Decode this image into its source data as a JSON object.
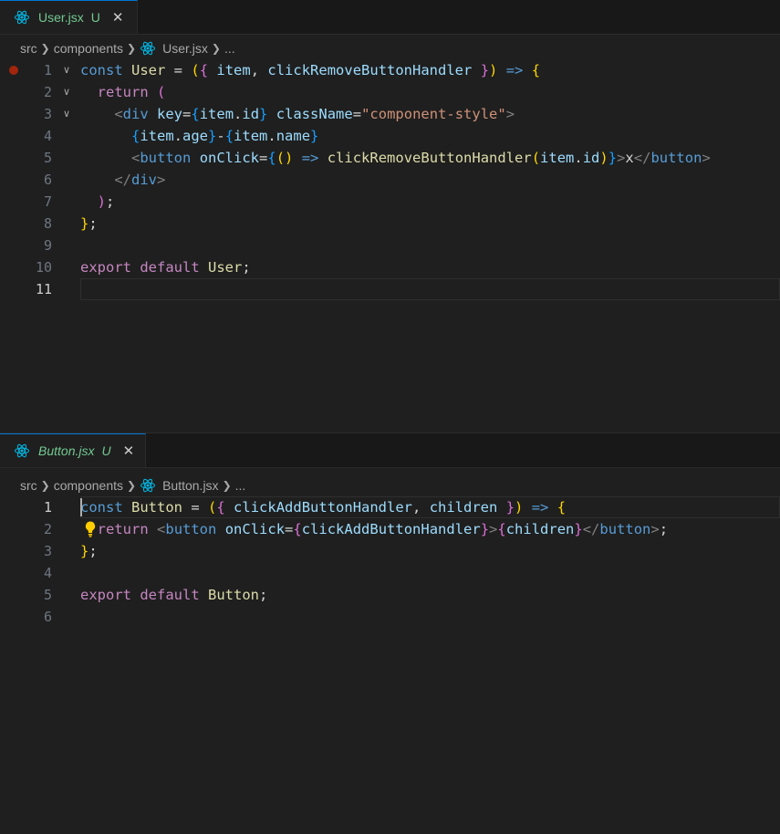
{
  "colors": {
    "accent": "#0078d4",
    "untracked": "#73c991",
    "breakpoint": "#a1260d",
    "react_icon": "#00b7e4",
    "bulb": "#ffcc00"
  },
  "panes": [
    {
      "tab": {
        "label": "User.jsx",
        "status": "U",
        "icon": "react-icon",
        "close": "✕"
      },
      "breadcrumb": {
        "parts": [
          "src",
          "components",
          "User.jsx",
          "..."
        ]
      },
      "lines": [
        {
          "number": "1",
          "active": false,
          "breakpoint": true,
          "fold": true,
          "tokens": [
            [
              "kw",
              "const"
            ],
            [
              "tx",
              " "
            ],
            [
              "fn",
              "User"
            ],
            [
              "tx",
              " = "
            ],
            [
              "b1",
              "("
            ],
            [
              "b2",
              "{"
            ],
            [
              "tx",
              " "
            ],
            [
              "vr",
              "item"
            ],
            [
              "tx",
              ", "
            ],
            [
              "vr",
              "clickRemoveButtonHandler"
            ],
            [
              "tx",
              " "
            ],
            [
              "b2",
              "}"
            ],
            [
              "b1",
              ")"
            ],
            [
              "tx",
              " "
            ],
            [
              "kw",
              "=>"
            ],
            [
              "tx",
              " "
            ],
            [
              "b1",
              "{"
            ]
          ]
        },
        {
          "number": "2",
          "active": false,
          "fold": true,
          "tokens": [
            [
              "tx",
              "  "
            ],
            [
              "kc",
              "return"
            ],
            [
              "tx",
              " "
            ],
            [
              "b2",
              "("
            ]
          ]
        },
        {
          "number": "3",
          "active": false,
          "fold": true,
          "tokens": [
            [
              "tx",
              "    "
            ],
            [
              "pu",
              "<"
            ],
            [
              "tg",
              "div"
            ],
            [
              "tx",
              " "
            ],
            [
              "at",
              "key"
            ],
            [
              "tx",
              "="
            ],
            [
              "b3",
              "{"
            ],
            [
              "vr",
              "item"
            ],
            [
              "tx",
              "."
            ],
            [
              "vr",
              "id"
            ],
            [
              "b3",
              "}"
            ],
            [
              "tx",
              " "
            ],
            [
              "at",
              "className"
            ],
            [
              "tx",
              "="
            ],
            [
              "st",
              "\"component-style\""
            ],
            [
              "pu",
              ">"
            ]
          ]
        },
        {
          "number": "4",
          "active": false,
          "tokens": [
            [
              "tx",
              "      "
            ],
            [
              "b3",
              "{"
            ],
            [
              "vr",
              "item"
            ],
            [
              "tx",
              "."
            ],
            [
              "vr",
              "age"
            ],
            [
              "b3",
              "}"
            ],
            [
              "tx",
              "-"
            ],
            [
              "b3",
              "{"
            ],
            [
              "vr",
              "item"
            ],
            [
              "tx",
              "."
            ],
            [
              "vr",
              "name"
            ],
            [
              "b3",
              "}"
            ]
          ]
        },
        {
          "number": "5",
          "active": false,
          "tokens": [
            [
              "tx",
              "      "
            ],
            [
              "pu",
              "<"
            ],
            [
              "tg",
              "button"
            ],
            [
              "tx",
              " "
            ],
            [
              "at",
              "onClick"
            ],
            [
              "tx",
              "="
            ],
            [
              "b3",
              "{"
            ],
            [
              "b1",
              "()"
            ],
            [
              "tx",
              " "
            ],
            [
              "kw",
              "=>"
            ],
            [
              "tx",
              " "
            ],
            [
              "fn",
              "clickRemoveButtonHandler"
            ],
            [
              "b1",
              "("
            ],
            [
              "vr",
              "item"
            ],
            [
              "tx",
              "."
            ],
            [
              "vr",
              "id"
            ],
            [
              "b1",
              ")"
            ],
            [
              "b3",
              "}"
            ],
            [
              "pu",
              ">"
            ],
            [
              "tx",
              "x"
            ],
            [
              "pu",
              "</"
            ],
            [
              "tg",
              "button"
            ],
            [
              "pu",
              ">"
            ]
          ]
        },
        {
          "number": "6",
          "active": false,
          "tokens": [
            [
              "tx",
              "    "
            ],
            [
              "pu",
              "</"
            ],
            [
              "tg",
              "div"
            ],
            [
              "pu",
              ">"
            ]
          ]
        },
        {
          "number": "7",
          "active": false,
          "tokens": [
            [
              "tx",
              "  "
            ],
            [
              "b2",
              ")"
            ],
            [
              "tx",
              ";"
            ]
          ]
        },
        {
          "number": "8",
          "active": false,
          "tokens": [
            [
              "b1",
              "}"
            ],
            [
              "tx",
              ";"
            ]
          ]
        },
        {
          "number": "9",
          "active": false,
          "tokens": []
        },
        {
          "number": "10",
          "active": false,
          "tokens": [
            [
              "kc",
              "export"
            ],
            [
              "tx",
              " "
            ],
            [
              "kc",
              "default"
            ],
            [
              "tx",
              " "
            ],
            [
              "fn",
              "User"
            ],
            [
              "tx",
              ";"
            ]
          ]
        },
        {
          "number": "11",
          "active": true,
          "current": true,
          "tokens": []
        }
      ]
    },
    {
      "tab": {
        "label": "Button.jsx",
        "status": "U",
        "icon": "react-icon",
        "close": "✕"
      },
      "breadcrumb": {
        "parts": [
          "src",
          "components",
          "Button.jsx",
          "..."
        ]
      },
      "lines": [
        {
          "number": "1",
          "active": true,
          "current": true,
          "cursor": true,
          "tokens": [
            [
              "kw",
              "const"
            ],
            [
              "tx",
              " "
            ],
            [
              "fn",
              "Button"
            ],
            [
              "tx",
              " = "
            ],
            [
              "b1",
              "("
            ],
            [
              "b2",
              "{"
            ],
            [
              "tx",
              " "
            ],
            [
              "vr",
              "clickAddButtonHandler"
            ],
            [
              "tx",
              ", "
            ],
            [
              "vr",
              "children"
            ],
            [
              "tx",
              " "
            ],
            [
              "b2",
              "}"
            ],
            [
              "b1",
              ")"
            ],
            [
              "tx",
              " "
            ],
            [
              "kw",
              "=>"
            ],
            [
              "tx",
              " "
            ],
            [
              "b1",
              "{"
            ]
          ]
        },
        {
          "number": "2",
          "active": false,
          "lightbulb": true,
          "tokens": [
            [
              "tx",
              "  "
            ],
            [
              "kc",
              "return"
            ],
            [
              "tx",
              " "
            ],
            [
              "pu",
              "<"
            ],
            [
              "tg",
              "button"
            ],
            [
              "tx",
              " "
            ],
            [
              "at",
              "onClick"
            ],
            [
              "tx",
              "="
            ],
            [
              "b2",
              "{"
            ],
            [
              "vr",
              "clickAddButtonHandler"
            ],
            [
              "b2",
              "}"
            ],
            [
              "pu",
              ">"
            ],
            [
              "b2",
              "{"
            ],
            [
              "vr",
              "children"
            ],
            [
              "b2",
              "}"
            ],
            [
              "pu",
              "</"
            ],
            [
              "tg",
              "button"
            ],
            [
              "pu",
              ">"
            ],
            [
              "tx",
              ";"
            ]
          ]
        },
        {
          "number": "3",
          "active": false,
          "tokens": [
            [
              "b1",
              "}"
            ],
            [
              "tx",
              ";"
            ]
          ]
        },
        {
          "number": "4",
          "active": false,
          "tokens": []
        },
        {
          "number": "5",
          "active": false,
          "tokens": [
            [
              "kc",
              "export"
            ],
            [
              "tx",
              " "
            ],
            [
              "kc",
              "default"
            ],
            [
              "tx",
              " "
            ],
            [
              "fn",
              "Button"
            ],
            [
              "tx",
              ";"
            ]
          ]
        },
        {
          "number": "6",
          "active": false,
          "tokens": []
        }
      ]
    }
  ]
}
